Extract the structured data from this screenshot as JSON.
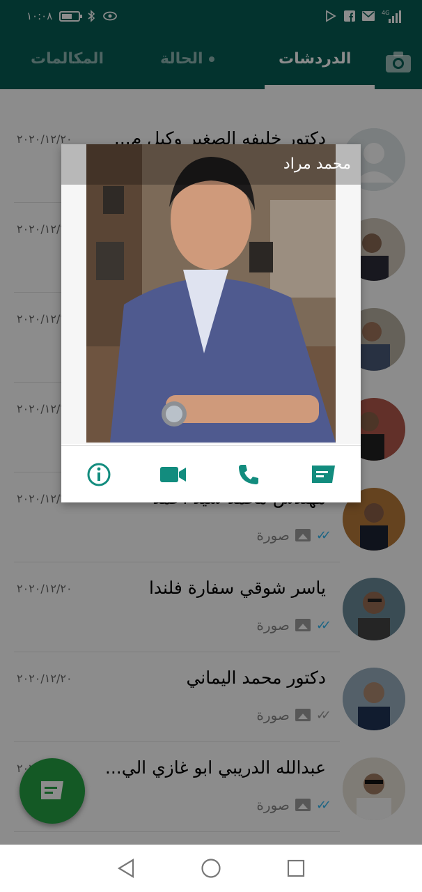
{
  "status_bar": {
    "time": "١٠:٠٨"
  },
  "tabs": {
    "calls": "المكالمات",
    "status": "الحالة",
    "chats": "الدردشات"
  },
  "chats": [
    {
      "name": "دكتور خليفه الصغير وكيل م...",
      "date": "٢٠٢٠/١٢/٢٠",
      "preview": "",
      "ticks": "blue"
    },
    {
      "name": "",
      "date": "٢٠٢٠/١٢/٢٠",
      "preview": "",
      "ticks": "blue"
    },
    {
      "name": "",
      "date": "٢٠٢٠/١٢/٢٠",
      "preview": "",
      "ticks": "blue"
    },
    {
      "name": "",
      "date": "٢٠٢٠/١٢/٢٠",
      "preview": "",
      "ticks": "blue"
    },
    {
      "name": "مهندس محمد سيد احمد",
      "date": "٢٠٢٠/١٢/٢٠",
      "preview": "صورة",
      "ticks": "blue"
    },
    {
      "name": "ياسر شوقي سفارة فلندا",
      "date": "٢٠٢٠/١٢/٢٠",
      "preview": "صورة",
      "ticks": "blue"
    },
    {
      "name": "دكتور محمد اليماني",
      "date": "٢٠٢٠/١٢/٢٠",
      "preview": "صورة",
      "ticks": "grey"
    },
    {
      "name": "عبدالله الدريبي ابو غازي الي...",
      "date": "٢٠٢٠/١٢/٢٠",
      "preview": "صورة",
      "ticks": "blue"
    }
  ],
  "popup": {
    "contact_name": "محمد مراد"
  },
  "colors": {
    "header": "#075e54",
    "accent": "#128c7e",
    "fab": "#25a244",
    "read_ticks": "#34b7f1"
  }
}
